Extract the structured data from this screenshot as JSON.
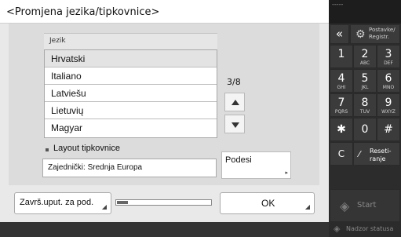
{
  "screen": {
    "title": "<Promjena jezika/tipkovnice>"
  },
  "language_list": {
    "header": "Jezik",
    "items": [
      "Hrvatski",
      "Italiano",
      "Latviešu",
      "Lietuvių",
      "Magyar"
    ],
    "selected_index": 0,
    "page_counter": "3/8"
  },
  "keyboard_layout": {
    "label": "Layout tipkovnice",
    "value": "Zajednički: Srednja Europa",
    "setup_button": "Podesi"
  },
  "footer": {
    "finish_button": "Završ.uput. za pod.",
    "progress_fraction": 0.12,
    "ok_button": "OK"
  },
  "keypad": {
    "top_dashes": "-----",
    "back_glyph": "«",
    "prefs_label": "Postavke/ Registr.",
    "keys": [
      {
        "num": "1",
        "letters": ""
      },
      {
        "num": "2",
        "letters": "ABC"
      },
      {
        "num": "3",
        "letters": "DEF"
      },
      {
        "num": "4",
        "letters": "GHI"
      },
      {
        "num": "5",
        "letters": "JKL"
      },
      {
        "num": "6",
        "letters": "MNO"
      },
      {
        "num": "7",
        "letters": "PQRS"
      },
      {
        "num": "8",
        "letters": "TUV"
      },
      {
        "num": "9",
        "letters": "WXYZ"
      },
      {
        "num": "✱",
        "letters": ""
      },
      {
        "num": "0",
        "letters": ""
      },
      {
        "num": "#",
        "letters": ""
      }
    ],
    "clear_label": "C",
    "reset_label": "Reseti- ranje",
    "start_label": "Start"
  },
  "status": {
    "label": "Nadzor statusa"
  },
  "colors": {
    "panel": "#dcdcdc",
    "keypad": "#2c2c2c",
    "key": "#3b3b3b"
  }
}
